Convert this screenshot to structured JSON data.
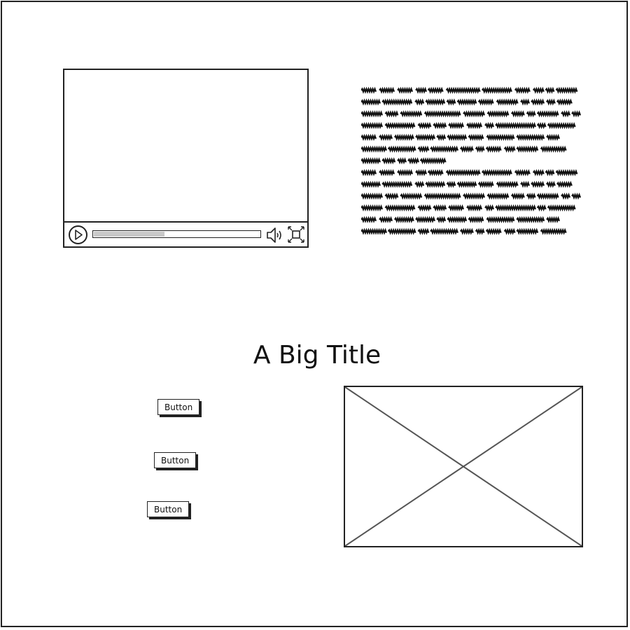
{
  "video": {
    "progress": 0.43,
    "icons": {
      "play": "play-icon",
      "volume": "volume-icon",
      "fullscreen": "fullscreen-icon"
    }
  },
  "text_block": {
    "content": "Lorem ipsum dolor sit amet, consectetur adipiscing elit, sed do eiusmod tempor incididunt ut labore et dolore magna aliqua. Ut enim ad minim veniam, quis nostrud exercitation ullamco laboris nisi ut aliquip ex ea commodo consequat. Duis aute irure dolor in reprehenderit in voluptate velit esse cillum dolore eu fugiat nulla pariatur. Excepteur sint occaecat cupidatat non proident, sunt in culpa qui officia deserunt mollit anim id est laborum."
  },
  "title": "A Big Title",
  "buttons": [
    {
      "label": "Button"
    },
    {
      "label": "Button"
    },
    {
      "label": "Button"
    }
  ],
  "image_placeholder": {
    "icon": "image-placeholder-icon"
  }
}
